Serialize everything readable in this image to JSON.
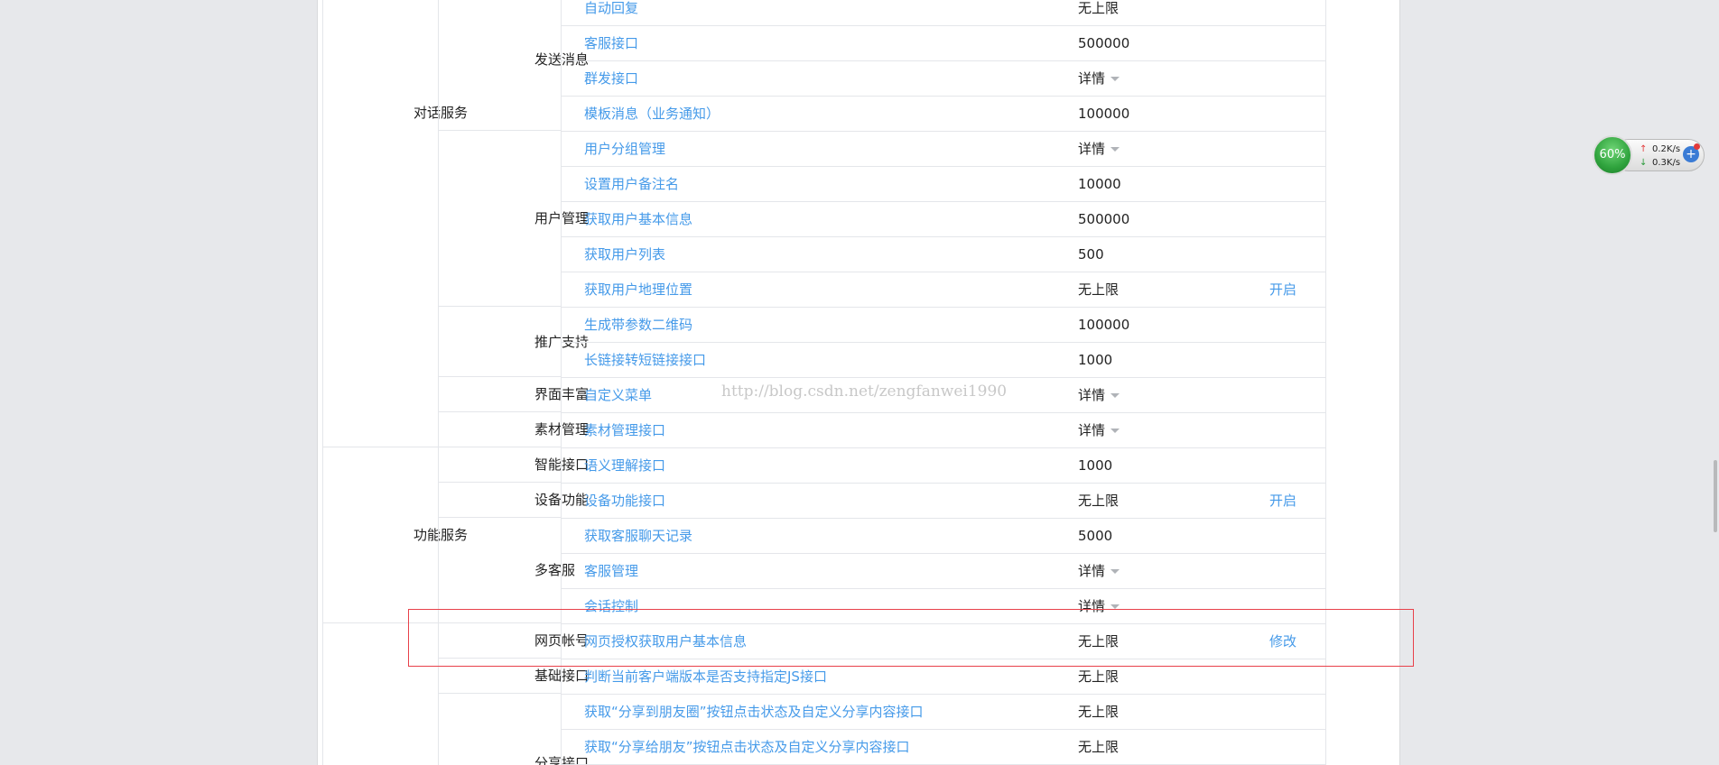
{
  "categories": [
    {
      "label": "对话服务"
    },
    {
      "label": "功能服务"
    }
  ],
  "groups": [
    {
      "label": "发送消息"
    },
    {
      "label": "用户管理"
    },
    {
      "label": "推广支持"
    },
    {
      "label": "界面丰富"
    },
    {
      "label": "素材管理"
    },
    {
      "label": "智能接口"
    },
    {
      "label": "设备功能"
    },
    {
      "label": "多客服"
    },
    {
      "label": "网页帐号"
    },
    {
      "label": "基础接口"
    },
    {
      "label": "分享接口"
    }
  ],
  "rows": [
    {
      "name": "自动回复",
      "value": "无上限",
      "action": ""
    },
    {
      "name": "客服接口",
      "value": "500000",
      "action": ""
    },
    {
      "name": "群发接口",
      "value": "详情",
      "action": ""
    },
    {
      "name": "模板消息（业务通知）",
      "value": "100000",
      "action": ""
    },
    {
      "name": "用户分组管理",
      "value": "详情",
      "action": ""
    },
    {
      "name": "设置用户备注名",
      "value": "10000",
      "action": ""
    },
    {
      "name": "获取用户基本信息",
      "value": "500000",
      "action": ""
    },
    {
      "name": "获取用户列表",
      "value": "500",
      "action": ""
    },
    {
      "name": "获取用户地理位置",
      "value": "无上限",
      "action": "开启"
    },
    {
      "name": "生成带参数二维码",
      "value": "100000",
      "action": ""
    },
    {
      "name": "长链接转短链接接口",
      "value": "1000",
      "action": ""
    },
    {
      "name": "自定义菜单",
      "value": "详情",
      "action": ""
    },
    {
      "name": "素材管理接口",
      "value": "详情",
      "action": ""
    },
    {
      "name": "语义理解接口",
      "value": "1000",
      "action": ""
    },
    {
      "name": "设备功能接口",
      "value": "无上限",
      "action": "开启"
    },
    {
      "name": "获取客服聊天记录",
      "value": "5000",
      "action": ""
    },
    {
      "name": "客服管理",
      "value": "详情",
      "action": ""
    },
    {
      "name": "会话控制",
      "value": "详情",
      "action": ""
    },
    {
      "name": "网页授权获取用户基本信息",
      "value": "无上限",
      "action": "修改"
    },
    {
      "name": "判断当前客户端版本是否支持指定JS接口",
      "value": "无上限",
      "action": ""
    },
    {
      "name": "获取“分享到朋友圈”按钮点击状态及自定义分享内容接口",
      "value": "无上限",
      "action": ""
    },
    {
      "name": "获取“分享给朋友”按钮点击状态及自定义分享内容接口",
      "value": "无上限",
      "action": ""
    }
  ],
  "watermark": "http://blog.csdn.net/zengfanwei1990",
  "net_widget": {
    "percent": "60%",
    "upload": "0.2K/s",
    "download": "0.3K/s",
    "upload_arrow": "↑",
    "download_arrow": "↓",
    "plus": "+"
  }
}
